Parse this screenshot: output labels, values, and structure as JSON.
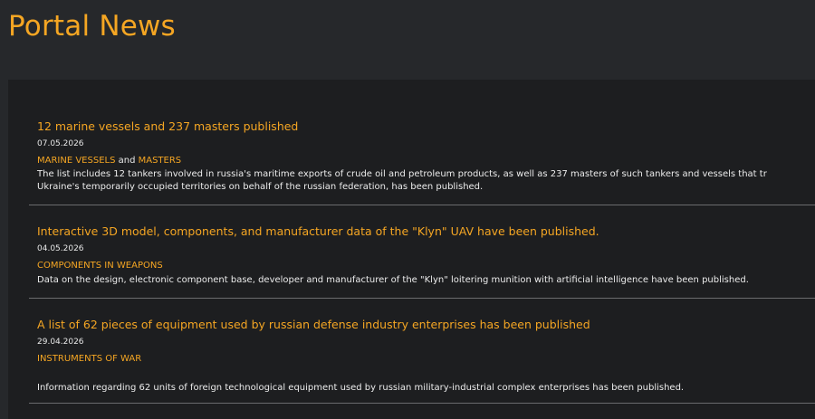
{
  "header": {
    "title": "Portal News"
  },
  "news": [
    {
      "title": "12 marine vessels and 237 masters published",
      "date": "07.05.2026",
      "tags": [
        "MARINE VESSELS",
        "MASTERS"
      ],
      "tag_joiner": " and ",
      "text_line1": "The list includes 12 tankers involved in russia's maritime exports of crude oil and petroleum products, as well as 237 masters of such tankers and vessels that tr",
      "text_line2": "Ukraine's temporarily occupied territories on behalf of the russian federation, has been published."
    },
    {
      "title": "Interactive 3D model, components, and manufacturer data of the \"Klyn\" UAV have been published.",
      "date": "04.05.2026",
      "tags": [
        "COMPONENTS IN WEAPONS"
      ],
      "text_line1": "Data on the design, electronic component base, developer and manufacturer of the \"Klyn\" loitering munition with artificial intelligence have been published."
    },
    {
      "title": "A list of 62 pieces of equipment used by russian defense industry enterprises has been published",
      "date": "29.04.2026",
      "tags": [
        "INSTRUMENTS OF WAR"
      ],
      "text_line1": "Information regarding 62 units of foreign technological equipment used by russian military-industrial complex enterprises has been published."
    }
  ],
  "colors": {
    "accent": "#f5a623",
    "header_bg": "#26282b",
    "panel_bg": "#1d1e20",
    "text": "#ececec",
    "divider": "#6a6b6e"
  }
}
